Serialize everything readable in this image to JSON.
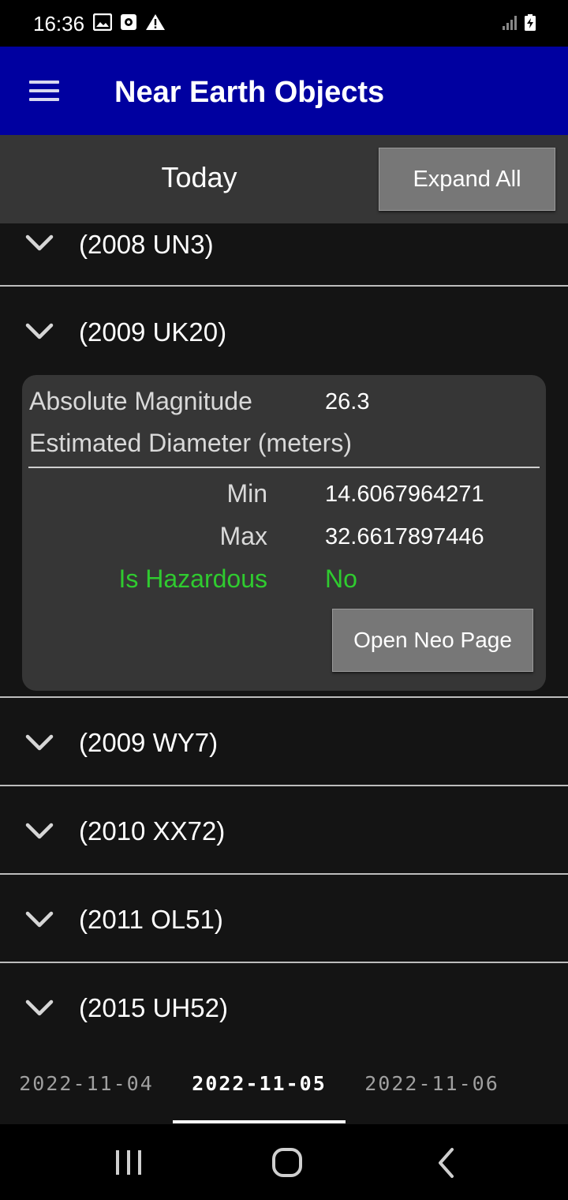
{
  "status_bar": {
    "time": "16:36",
    "left_icons": [
      "image-icon",
      "camera-icon",
      "warning-icon"
    ],
    "right_icons": [
      "signal-icon",
      "battery-icon"
    ]
  },
  "app_bar": {
    "title": "Near Earth Objects",
    "menu_icon": "hamburger-menu-icon"
  },
  "header": {
    "today_label": "Today",
    "expand_all_label": "Expand All"
  },
  "neo_items": [
    {
      "name": "(2008 UN3)"
    },
    {
      "name": "(2009 UK20)",
      "expanded": true,
      "details": {
        "absolute_magnitude_label": "Absolute Magnitude",
        "absolute_magnitude_value": "26.3",
        "estimated_diameter_label": "Estimated Diameter (meters)",
        "min_label": "Min",
        "min_value": "14.6067964271",
        "max_label": "Max",
        "max_value": "32.6617897446",
        "hazardous_label": "Is Hazardous",
        "hazardous_value": "No",
        "open_page_label": "Open Neo Page"
      }
    },
    {
      "name": "(2009 WY7)"
    },
    {
      "name": "(2010 XX72)"
    },
    {
      "name": "(2011 OL51)"
    },
    {
      "name": "(2015 UH52)"
    }
  ],
  "date_tabs": [
    {
      "label": "2022-11-04",
      "active": false
    },
    {
      "label": "2022-11-05",
      "active": true
    },
    {
      "label": "2022-11-06",
      "active": false
    }
  ],
  "nav_bar": {
    "buttons": [
      "recent-apps-icon",
      "home-icon",
      "back-icon"
    ]
  },
  "colors": {
    "app_bar": "#0000a0",
    "header_strip": "#363636",
    "background": "#141414",
    "hazard_green": "#2fcb2f",
    "button_grey": "#777777"
  }
}
